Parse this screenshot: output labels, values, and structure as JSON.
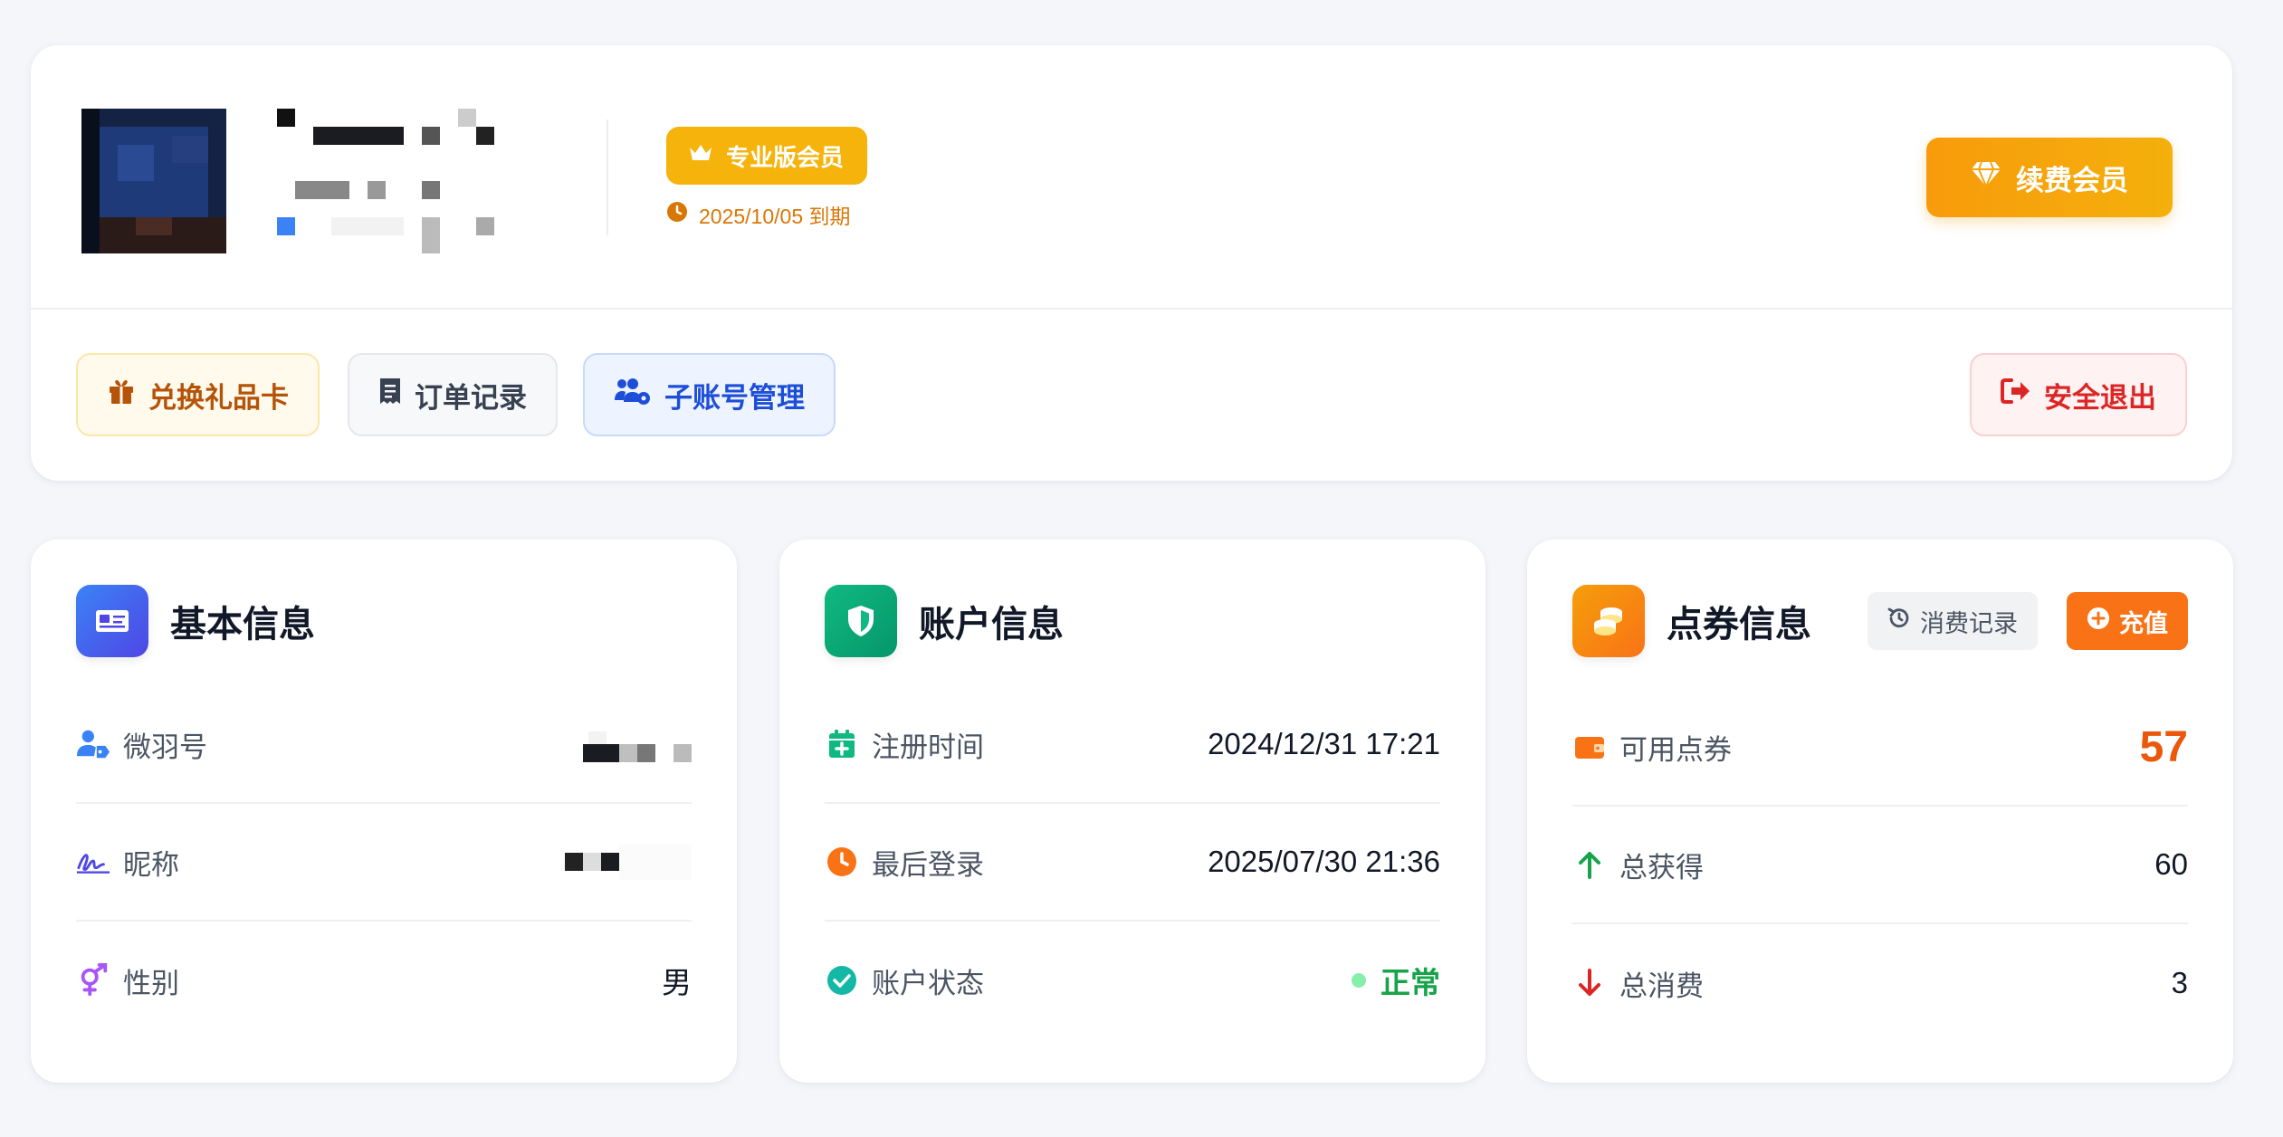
{
  "profile": {
    "member_badge": "专业版会员",
    "expire_text": "2025/10/05 到期",
    "renew_label": "续费会员"
  },
  "actions": {
    "gift": "兑换礼品卡",
    "orders": "订单记录",
    "sub_accounts": "子账号管理",
    "logout": "安全退出"
  },
  "basic": {
    "title": "基本信息",
    "rows": [
      {
        "label": "微羽号"
      },
      {
        "label": "昵称"
      },
      {
        "label": "性别",
        "value": "男"
      }
    ]
  },
  "account": {
    "title": "账户信息",
    "rows": [
      {
        "label": "注册时间",
        "value": "2024/12/31 17:21"
      },
      {
        "label": "最后登录",
        "value": "2025/07/30 21:36"
      },
      {
        "label": "账户状态",
        "value": "正常"
      }
    ]
  },
  "points": {
    "title": "点券信息",
    "consume_label": "消费记录",
    "recharge_label": "充值",
    "rows": [
      {
        "label": "可用点券",
        "value": "57"
      },
      {
        "label": "总获得",
        "value": "60"
      },
      {
        "label": "总消费",
        "value": "3"
      }
    ]
  },
  "colors": {
    "gold": "#f5b30b",
    "orange": "#f97316",
    "blue": "#3b5bfd",
    "green": "#10b981",
    "red": "#dc2626"
  }
}
